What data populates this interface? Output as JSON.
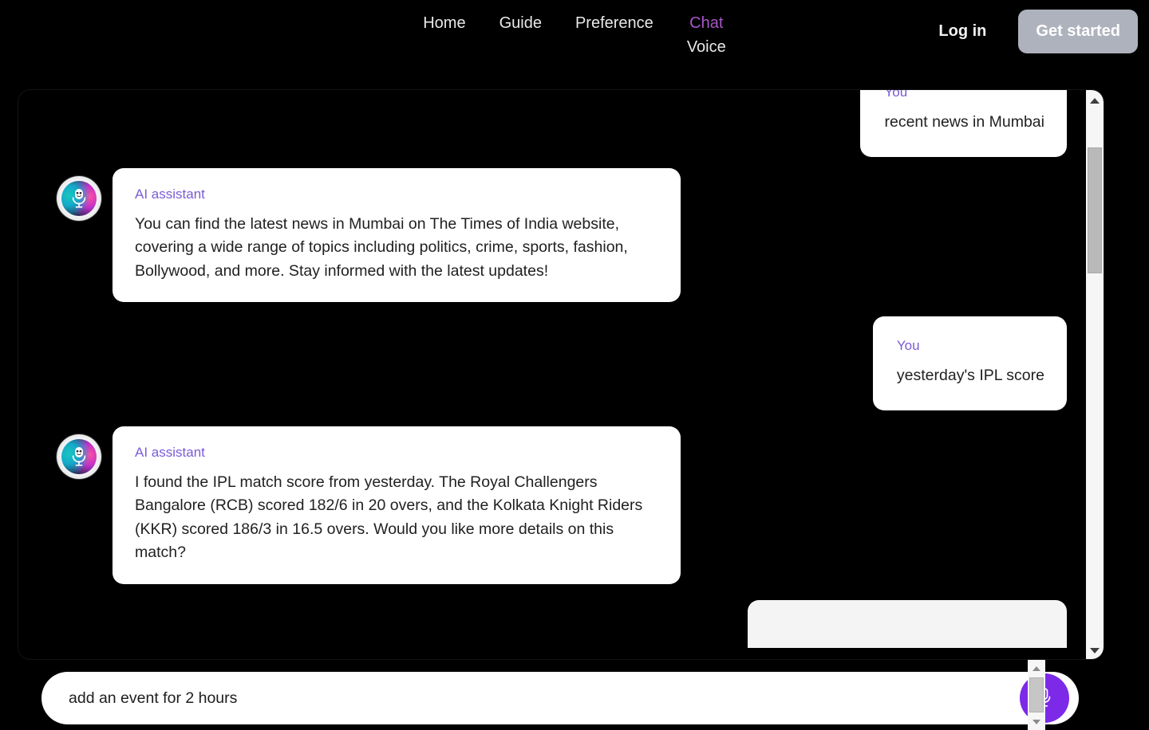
{
  "nav": {
    "items": [
      {
        "label": "Home",
        "active": false
      },
      {
        "label": "Guide",
        "active": false
      },
      {
        "label": "Preference",
        "active": false
      }
    ],
    "stacked": [
      {
        "label": "Chat",
        "active": true
      },
      {
        "label": "Voice",
        "active": false
      }
    ],
    "login_label": "Log in",
    "get_started_label": "Get started",
    "accent_color": "#a855c9",
    "get_started_bg": "#aeb2bd"
  },
  "chat": {
    "speaker_ai": "AI assistant",
    "speaker_user": "You",
    "speaker_color": "#7b5bd6",
    "messages": [
      {
        "role": "user",
        "speaker": "You",
        "text": "recent news in Mumbai"
      },
      {
        "role": "ai",
        "speaker": "AI assistant",
        "text": "You can find the latest news in Mumbai on The Times of India website, covering a wide range of topics including politics, crime, sports, fashion, Bollywood, and more. Stay informed with the latest updates!"
      },
      {
        "role": "user",
        "speaker": "You",
        "text": "yesterday's IPL score"
      },
      {
        "role": "ai",
        "speaker": "AI assistant",
        "text": "I found the IPL match score from yesterday. The Royal Challengers Bangalore (RCB) scored 182/6 in 20 overs, and the Kolkata Knight Riders (KKR) scored 186/3 in 16.5 overs. Would you like more details on this match?"
      }
    ],
    "avatar_icon": "robot-microphone-icon"
  },
  "composer": {
    "value": "add an event for 2 hours",
    "placeholder": "add an event for 2 hours",
    "mic_icon": "microphone-icon",
    "mic_color": "#7c2ae8"
  },
  "scrollbar": {
    "up_icon": "caret-up-icon",
    "down_icon": "caret-down-icon"
  }
}
